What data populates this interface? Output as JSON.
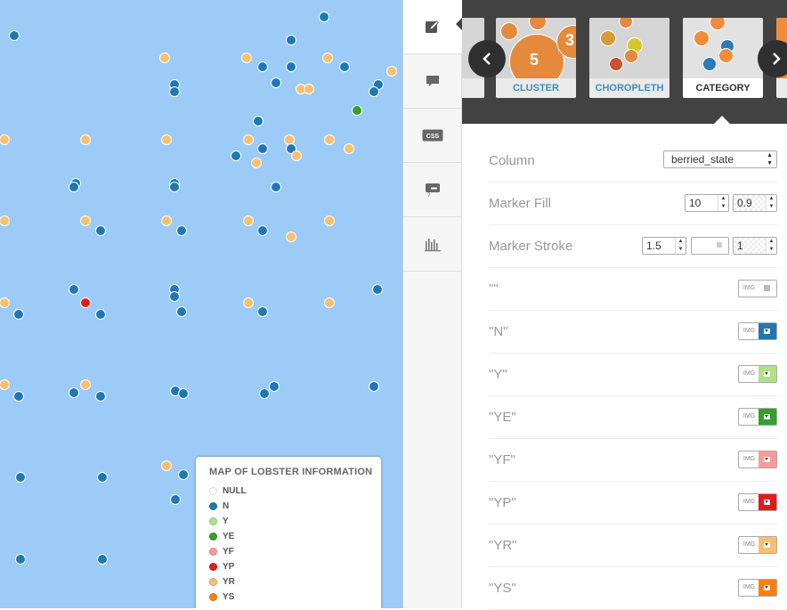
{
  "map": {
    "legend": {
      "title": "MAP OF LOBSTER INFORMATION",
      "items": [
        {
          "label": "NULL",
          "color": "#ffffff"
        },
        {
          "label": "N",
          "color": "#1f78b4"
        },
        {
          "label": "Y",
          "color": "#b2df8a"
        },
        {
          "label": "YE",
          "color": "#33a02c"
        },
        {
          "label": "YF",
          "color": "#fb9a99"
        },
        {
          "label": "YP",
          "color": "#e31a1c"
        },
        {
          "label": "YR",
          "color": "#fdbf6f"
        },
        {
          "label": "YS",
          "color": "#ff7f00"
        }
      ]
    }
  },
  "toolbar": {
    "items": [
      {
        "icon": "wizard-edit-icon",
        "active": true
      },
      {
        "icon": "infowindow-icon",
        "active": false
      },
      {
        "icon": "css-icon",
        "active": false
      },
      {
        "icon": "legend-icon",
        "active": false
      },
      {
        "icon": "histogram-icon",
        "active": false
      }
    ]
  },
  "wizard_gallery": {
    "thumbnails": [
      {
        "label": "CLUSTER",
        "selected": false,
        "numbers": [
          "5",
          "3"
        ]
      },
      {
        "label": "CHOROPLETH",
        "selected": false
      },
      {
        "label": "CATEGORY",
        "selected": true
      }
    ]
  },
  "properties": {
    "column": {
      "label": "Column",
      "value": "berried_state"
    },
    "marker_fill": {
      "label": "Marker Fill",
      "width": "10",
      "opacity": "0.9"
    },
    "marker_stroke": {
      "label": "Marker Stroke",
      "width": "1.5",
      "opacity": "1"
    },
    "categories": [
      {
        "label": "\"\"",
        "swatch": "",
        "img_label": "IMG"
      },
      {
        "label": "\"N\"",
        "swatch": "#1f78b4",
        "img_label": "IMG"
      },
      {
        "label": "\"Y\"",
        "swatch": "#b2df8a",
        "img_label": "IMG"
      },
      {
        "label": "\"YE\"",
        "swatch": "#33a02c",
        "img_label": "IMG"
      },
      {
        "label": "\"YF\"",
        "swatch": "#fb9a99",
        "img_label": "IMG"
      },
      {
        "label": "\"YP\"",
        "swatch": "#e31a1c",
        "img_label": "IMG"
      },
      {
        "label": "\"YR\"",
        "swatch": "#fdbf6f",
        "img_label": "IMG"
      },
      {
        "label": "\"YS\"",
        "swatch": "#ff7f00",
        "img_label": "IMG"
      }
    ]
  }
}
